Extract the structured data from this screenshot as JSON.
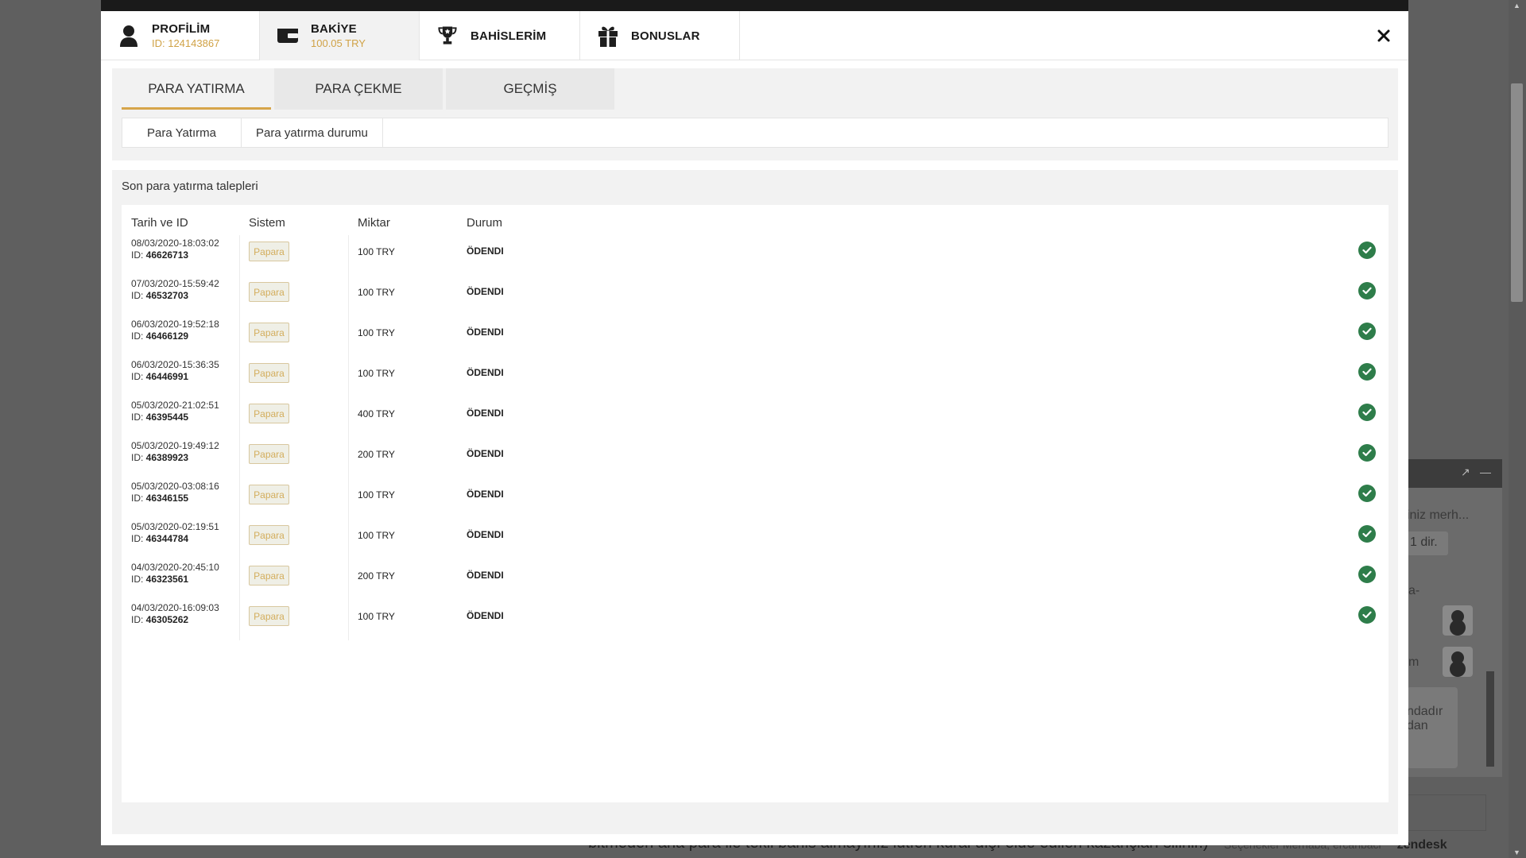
{
  "background": {
    "footer_text": "bitmeden ana para ile tekli bahis almayınız lütfen kural dışı elde edilen kazançları silinir.)",
    "chat": {
      "input_placeholder_fragment": "iniz merh...",
      "chip_fragment": "1 dir.",
      "frag_a": "a-",
      "frag_m": "m",
      "bubble_fragment_1": "ndadır",
      "bubble_fragment_2": "dan"
    },
    "zendesk_links": "Seçenekler   Merhaba, ercanbaci",
    "zendesk_brand": "zendesk"
  },
  "header": {
    "tabs": [
      {
        "label": "PROFİLİM",
        "sub": "ID: 124143867",
        "icon": "user-icon"
      },
      {
        "label": "BAKİYE",
        "sub": "100.05 TRY",
        "icon": "wallet-icon"
      },
      {
        "label": "BAHİSLERİM",
        "sub": "",
        "icon": "trophy-icon"
      },
      {
        "label": "BONUSLAR",
        "sub": "",
        "icon": "gift-icon"
      }
    ],
    "close_icon": "close-icon"
  },
  "subtabs": [
    {
      "label": "PARA YATIRMA",
      "active": true
    },
    {
      "label": "PARA ÇEKME",
      "active": false
    },
    {
      "label": "GEÇMİŞ",
      "active": false
    }
  ],
  "pills": [
    {
      "label": "Para Yatırma"
    },
    {
      "label": "Para yatırma durumu"
    }
  ],
  "section_title": "Son para yatırma talepleri",
  "table": {
    "columns": [
      "Tarih ve ID",
      "Sistem",
      "Miktar",
      "Durum"
    ],
    "id_prefix": "ID: ",
    "rows": [
      {
        "date": "08/03/2020-18:03:02",
        "id": "46626713",
        "system": "Papara",
        "amount": "100 TRY",
        "status": "ÖDENDI"
      },
      {
        "date": "07/03/2020-15:59:42",
        "id": "46532703",
        "system": "Papara",
        "amount": "100 TRY",
        "status": "ÖDENDI"
      },
      {
        "date": "06/03/2020-19:52:18",
        "id": "46466129",
        "system": "Papara",
        "amount": "100 TRY",
        "status": "ÖDENDI"
      },
      {
        "date": "06/03/2020-15:36:35",
        "id": "46446991",
        "system": "Papara",
        "amount": "100 TRY",
        "status": "ÖDENDI"
      },
      {
        "date": "05/03/2020-21:02:51",
        "id": "46395445",
        "system": "Papara",
        "amount": "400 TRY",
        "status": "ÖDENDI"
      },
      {
        "date": "05/03/2020-19:49:12",
        "id": "46389923",
        "system": "Papara",
        "amount": "200 TRY",
        "status": "ÖDENDI"
      },
      {
        "date": "05/03/2020-03:08:16",
        "id": "46346155",
        "system": "Papara",
        "amount": "100 TRY",
        "status": "ÖDENDI"
      },
      {
        "date": "05/03/2020-02:19:51",
        "id": "46344784",
        "system": "Papara",
        "amount": "100 TRY",
        "status": "ÖDENDI"
      },
      {
        "date": "04/03/2020-20:45:10",
        "id": "46323561",
        "system": "Papara",
        "amount": "200 TRY",
        "status": "ÖDENDI"
      },
      {
        "date": "04/03/2020-16:09:03",
        "id": "46305262",
        "system": "Papara",
        "amount": "100 TRY",
        "status": "ÖDENDI"
      }
    ]
  },
  "colors": {
    "accent": "#d6a54a",
    "badge_text": "#d3ad5c",
    "success": "#2e7d4a"
  }
}
